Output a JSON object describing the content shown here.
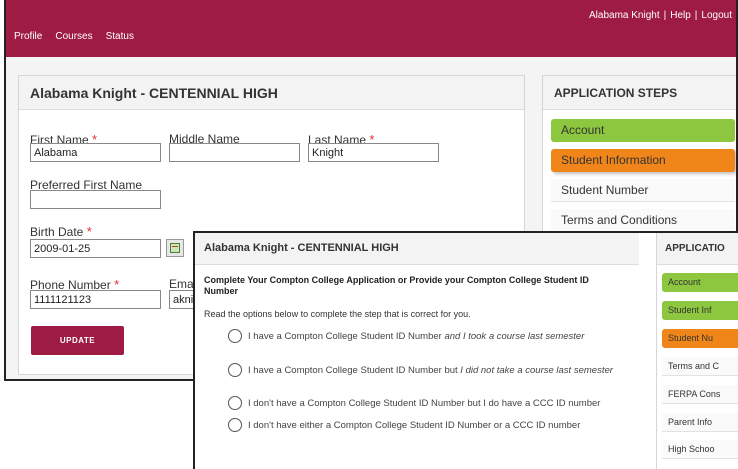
{
  "header": {
    "nav": [
      "Profile",
      "Courses",
      "Status"
    ],
    "user_name": "Alabama Knight",
    "separator": "|",
    "help": "Help",
    "logout": "Logout"
  },
  "profile_panel": {
    "title": "Alabama Knight - CENTENNIAL HIGH",
    "first_name_label": "First Name",
    "first_name_value": "Alabama",
    "middle_name_label": "Middle Name",
    "middle_name_value": "",
    "last_name_label": "Last Name",
    "last_name_value": "Knight",
    "preferred_label": "Preferred First Name",
    "preferred_value": "",
    "birth_label": "Birth Date",
    "birth_value": "2009-01-25",
    "phone_label": "Phone Number",
    "phone_value": "1111121123",
    "email_label": "Emai",
    "email_value": "akni",
    "required_mark": "*",
    "update_label": "UPDATE"
  },
  "steps_panel": {
    "title": "APPLICATION STEPS",
    "steps": [
      {
        "label": "Account",
        "status": "complete"
      },
      {
        "label": "Student Information",
        "status": "current"
      },
      {
        "label": "Student Number",
        "status": "pending"
      },
      {
        "label": "Terms and Conditions",
        "status": "pending"
      }
    ]
  },
  "front": {
    "title": "Alabama Knight - CENTENNIAL HIGH",
    "prompt": "Complete Your Compton College Application or Provide your Compton College Student ID Number",
    "instructions": "Read the options below to complete the step that is correct for you.",
    "options": [
      {
        "text": "I have a Compton College Student ID Number ",
        "italic": "and I took a course last semester"
      },
      {
        "text": "I have a Compton College Student ID Number but ",
        "italic": "I did not take a course last semester"
      },
      {
        "text": "I don't have a Compton College Student ID Number but I do have a CCC ID number",
        "italic": ""
      },
      {
        "text": "I don't have either a Compton College Student ID Number or a CCC ID number",
        "italic": ""
      }
    ],
    "steps_title": "APPLICATIO",
    "steps": [
      {
        "label": "Account",
        "status": "complete"
      },
      {
        "label": "Student Inf",
        "status": "complete"
      },
      {
        "label": "Student Nu",
        "status": "current"
      },
      {
        "label": "Terms and C",
        "status": "pending"
      },
      {
        "label": "FERPA Cons",
        "status": "pending"
      },
      {
        "label": "Parent Info",
        "status": "pending"
      },
      {
        "label": "High Schoo",
        "status": "pending"
      }
    ]
  },
  "colors": {
    "brand": "#9e1b44",
    "complete": "#8dc63f",
    "current": "#f08619"
  },
  "icons": {
    "calendar": "calendar-icon",
    "radio": "radio-button"
  }
}
